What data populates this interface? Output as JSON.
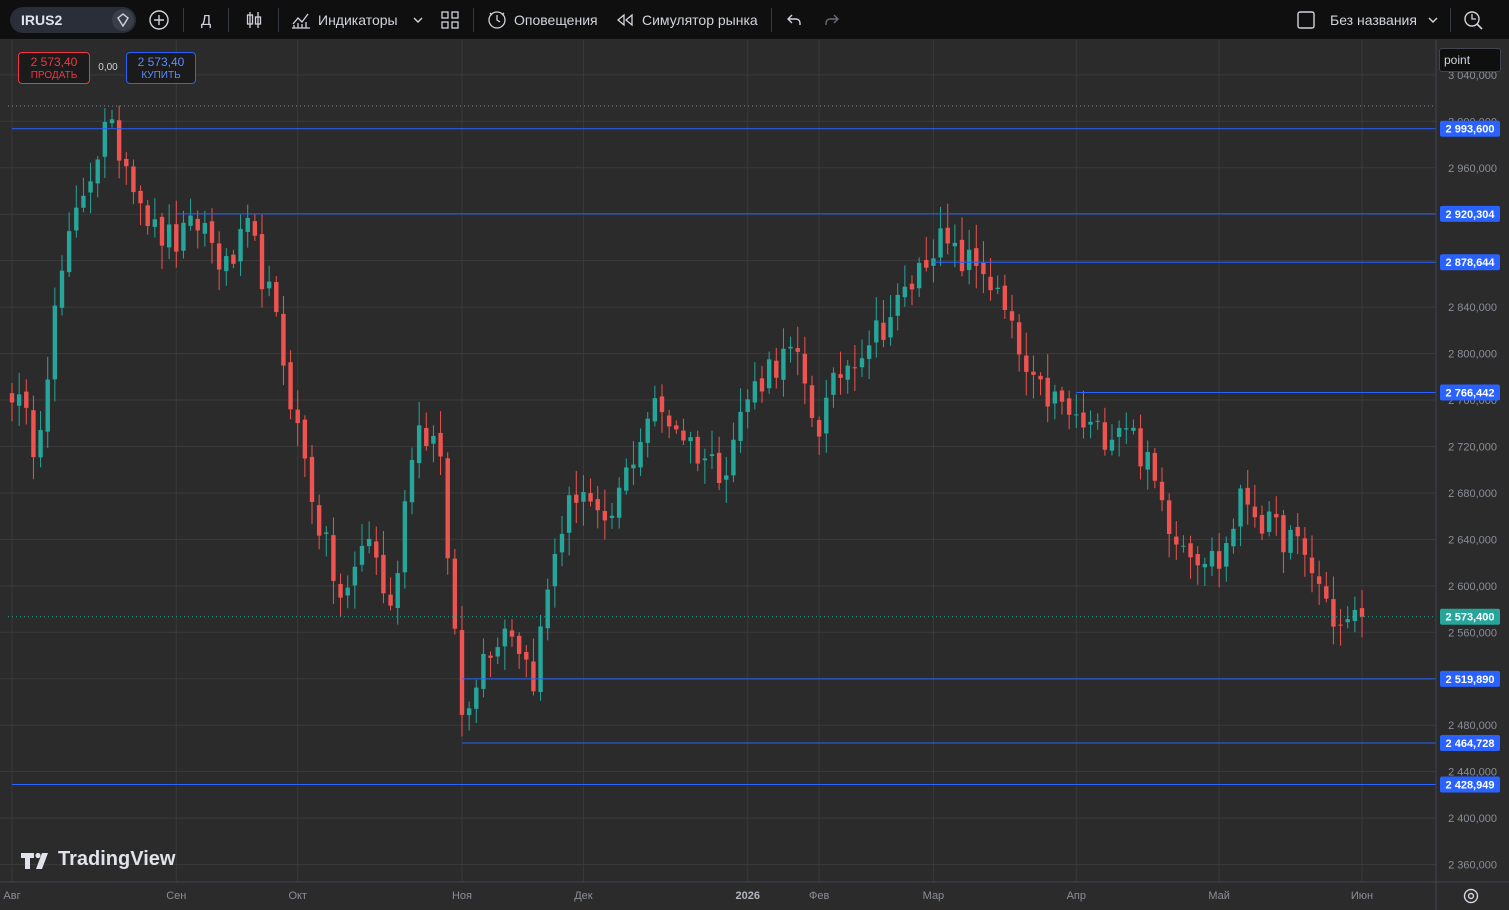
{
  "toolbar": {
    "symbol": "IRUS2",
    "interval": "Д",
    "indicators_label": "Индикаторы",
    "alerts_label": "Оповещения",
    "replay_label": "Симулятор рынка",
    "layout_name": "Без названия",
    "icons": [
      "symbol-search-icon",
      "add-symbol-icon",
      "candles-icon",
      "indicators-icon",
      "chevron-down-icon",
      "layout-grid-icon",
      "alert-clock-icon",
      "replay-icon",
      "undo-icon",
      "redo-icon",
      "checkbox-icon",
      "quick-search-icon"
    ]
  },
  "trade_panel": {
    "sell_price": "2 573,40",
    "sell_label": "ПРОДАТЬ",
    "spread": "0,00",
    "buy_price": "2 573,40",
    "buy_label": "КУПИТЬ"
  },
  "price_scale": {
    "unit": "point",
    "ticks": [
      "3 040,000",
      "3 000,000",
      "2 960,000",
      "2 920,000",
      "2 880,000",
      "2 840,000",
      "2 800,000",
      "2 760,000",
      "2 720,000",
      "2 680,000",
      "2 640,000",
      "2 600,000",
      "2 560,000",
      "2 520,000",
      "2 480,000",
      "2 440,000",
      "2 400,000",
      "2 360,000"
    ]
  },
  "time_scale": {
    "labels": [
      "Авг",
      "Сен",
      "Окт",
      "Ноя",
      "Дек",
      "2026",
      "Фев",
      "Мар",
      "Апр",
      "Май",
      "Июн"
    ]
  },
  "branding": {
    "logo_text": "TradingView"
  },
  "colors": {
    "up": "#26a69a",
    "down": "#ef5350",
    "level_line": "#2962ff",
    "background": "#2b2b2b",
    "grid": "#3a3a3a"
  },
  "chart_data": {
    "type": "candlestick",
    "symbol": "IRUS2",
    "interval": "Д",
    "ylim": [
      2345,
      3070
    ],
    "current_price": 2573.4,
    "current_price_label": "2 573,400",
    "horizontal_levels": [
      {
        "price": 2993.6,
        "label": "2 993,600",
        "from": "Авг"
      },
      {
        "price": 2920.304,
        "label": "2 920,304",
        "from": "Сен"
      },
      {
        "price": 2878.644,
        "label": "2 878,644",
        "from": "Мар"
      },
      {
        "price": 2766.442,
        "label": "2 766,442",
        "from": "Апр"
      },
      {
        "price": 2519.89,
        "label": "2 519,890",
        "from": "Ноя"
      },
      {
        "price": 2464.728,
        "label": "2 464,728",
        "from": "Ноя"
      },
      {
        "price": 2428.949,
        "label": "2 428,949",
        "from": "Авг"
      }
    ],
    "anchors": [
      [
        "Авг",
        2770
      ],
      [
        "",
        2720
      ],
      [
        "",
        2860
      ],
      [
        "",
        2940
      ],
      [
        "",
        2995
      ],
      [
        "",
        2960
      ],
      [
        "",
        2905
      ],
      [
        "Сен",
        2895
      ],
      [
        "",
        2915
      ],
      [
        "",
        2870
      ],
      [
        "",
        2905
      ],
      [
        "",
        2840
      ],
      [
        "Окт",
        2740
      ],
      [
        "",
        2650
      ],
      [
        "",
        2580
      ],
      [
        "",
        2650
      ],
      [
        "",
        2575
      ],
      [
        "",
        2740
      ],
      [
        "",
        2720
      ],
      [
        "Ноя",
        2490
      ],
      [
        "",
        2545
      ],
      [
        "",
        2570
      ],
      [
        "",
        2520
      ],
      [
        "",
        2640
      ],
      [
        "Дек",
        2690
      ],
      [
        "",
        2640
      ],
      [
        "",
        2700
      ],
      [
        "",
        2755
      ],
      [
        "",
        2740
      ],
      [
        "",
        2715
      ],
      [
        "",
        2700
      ],
      [
        "2026",
        2760
      ],
      [
        "",
        2790
      ],
      [
        "",
        2800
      ],
      [
        "Фев",
        2735
      ],
      [
        "",
        2785
      ],
      [
        "",
        2810
      ],
      [
        "",
        2830
      ],
      [
        "",
        2860
      ],
      [
        "Мар",
        2900
      ],
      [
        "",
        2880
      ],
      [
        "",
        2875
      ],
      [
        "",
        2830
      ],
      [
        "",
        2770
      ],
      [
        "",
        2760
      ],
      [
        "Апр",
        2740
      ],
      [
        "",
        2730
      ],
      [
        "",
        2745
      ],
      [
        "",
        2700
      ],
      [
        "",
        2650
      ],
      [
        "",
        2630
      ],
      [
        "Май",
        2620
      ],
      [
        "",
        2680
      ],
      [
        "",
        2650
      ],
      [
        "",
        2640
      ],
      [
        "",
        2610
      ],
      [
        "",
        2563
      ],
      [
        "Июн",
        2573.4
      ]
    ]
  }
}
